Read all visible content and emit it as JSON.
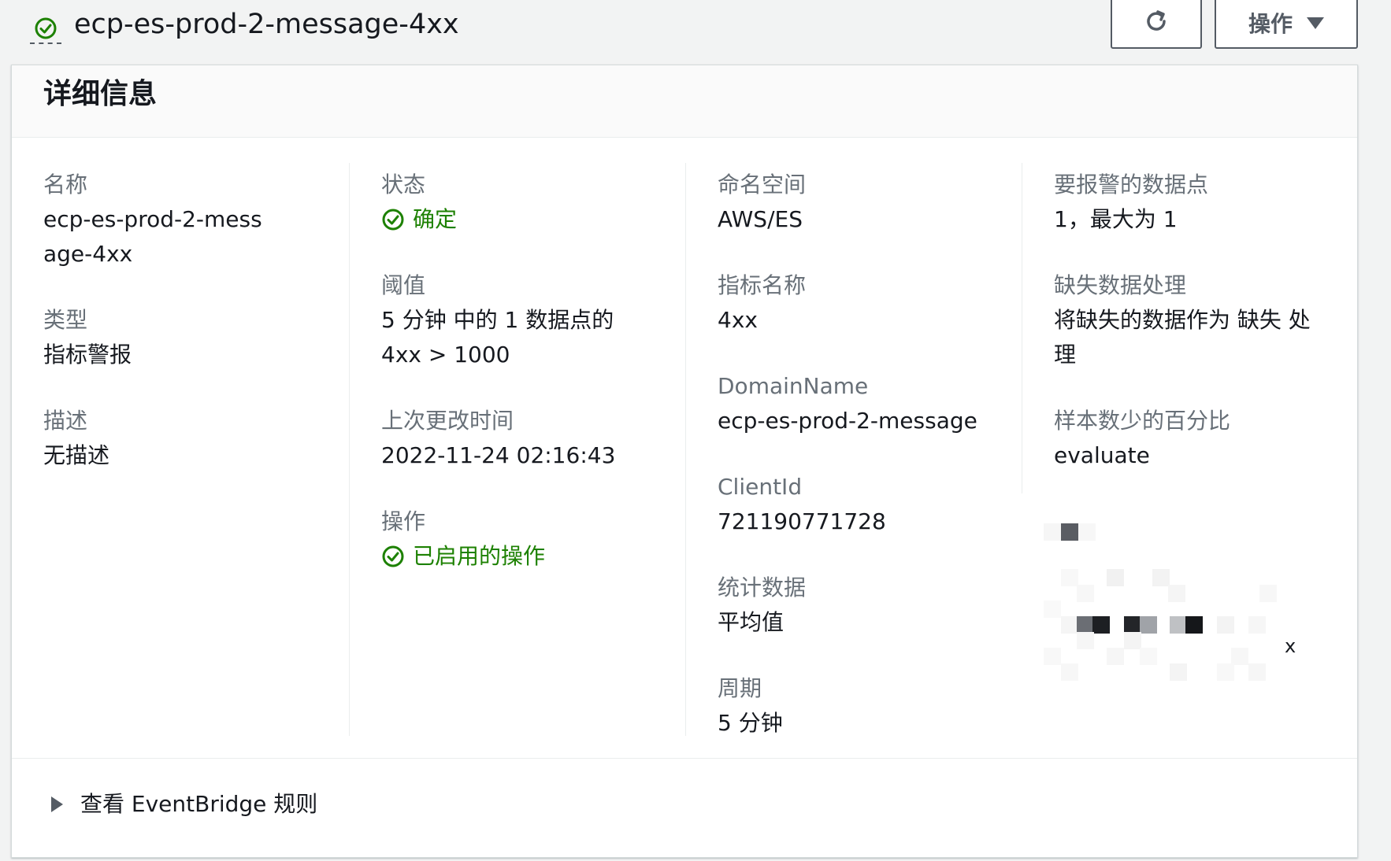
{
  "header": {
    "alarm_name": "ecp-es-prod-2-message-4xx",
    "actions_label": "操作",
    "status_icon": "check-circle-icon",
    "refresh_icon": "refresh-icon"
  },
  "panel": {
    "title": "详细信息",
    "columns": [
      {
        "fields": [
          {
            "label": "名称",
            "value": "ecp-es-prod-2-message-4xx"
          },
          {
            "label": "类型",
            "value": "指标警报"
          },
          {
            "label": "描述",
            "value": "无描述"
          }
        ]
      },
      {
        "fields": [
          {
            "label": "状态",
            "value": "确定"
          },
          {
            "label": "阈值",
            "value": "5 分钟 中的 1 数据点的 4xx > 1000"
          },
          {
            "label": "上次更改时间",
            "value": "2022-11-24 02:16:43"
          },
          {
            "label": "操作",
            "value": "已启用的操作"
          }
        ]
      },
      {
        "fields": [
          {
            "label": "命名空间",
            "value": "AWS/ES"
          },
          {
            "label": "指标名称",
            "value": "4xx"
          },
          {
            "label": "DomainName",
            "value": "ecp-es-prod-2-message"
          },
          {
            "label": "ClientId",
            "value": "721190771728"
          },
          {
            "label": "统计数据",
            "value": "平均值"
          },
          {
            "label": "周期",
            "value": "5 分钟"
          }
        ]
      },
      {
        "fields": [
          {
            "label": "要报警的数据点",
            "value": "1，最大为 1"
          },
          {
            "label": "缺失数据处理",
            "value": "将缺失的数据作为 缺失 处理"
          },
          {
            "label": "样本数少的百分比",
            "value": "evaluate"
          }
        ]
      }
    ],
    "redacted_trailing_char": "x"
  },
  "footer": {
    "expander_label": "查看 EventBridge 规则"
  },
  "colors": {
    "success": "#1d8102",
    "label": "#687078",
    "text": "#16191f",
    "border": "#545b64"
  }
}
